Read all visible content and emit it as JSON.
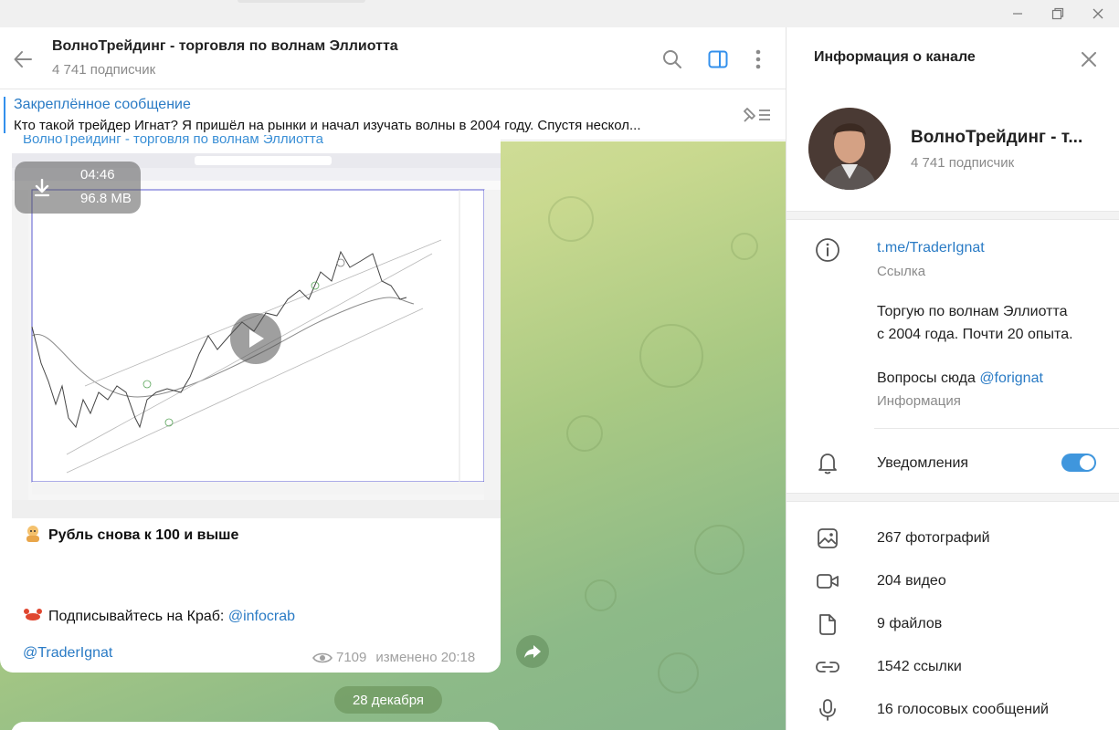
{
  "header": {
    "title": "ВолноТрейдинг - торговля по волнам Эллиотта",
    "subtitle": "4 741 подписчик"
  },
  "pinned": {
    "title": "Закреплённое сообщение",
    "text": "Кто такой трейдер Игнат?  Я пришёл на рынки и начал изучать волны в 2004 году. Спустя нескол..."
  },
  "message": {
    "sender": "ВолноТрейдинг - торговля по волнам Эллиотта",
    "video_duration": "04:46",
    "video_size": "96.8 MB",
    "line1": "Рубль снова к 100 и выше",
    "line2_prefix": "Подписывайтесь на Краб: ",
    "line2_link": "@infocrab",
    "line3": "@TraderIgnat",
    "views": "7109",
    "edited": "изменено 20:18"
  },
  "date_separator": "28 декабря",
  "info_panel": {
    "title": "Информация о канале",
    "channel_name": "ВолноТрейдинг - т...",
    "subscribers": "4 741 подписчик",
    "link": "t.me/TraderIgnat",
    "link_label": "Ссылка",
    "description_line1": "Торгую по волнам Эллиотта",
    "description_line2": "с 2004 года. Почти 20 опыта.",
    "description_line3_prefix": "Вопросы сюда ",
    "description_line3_link": "@forignat",
    "description_label": "Информация",
    "notifications_label": "Уведомления",
    "notifications_on": true,
    "media": [
      {
        "label": "267 фотографий",
        "icon": "photo-icon"
      },
      {
        "label": "204 видео",
        "icon": "video-icon"
      },
      {
        "label": "9 файлов",
        "icon": "file-icon"
      },
      {
        "label": "1542 ссылки",
        "icon": "link-icon"
      },
      {
        "label": "16 голосовых сообщений",
        "icon": "microphone-icon"
      }
    ]
  },
  "colors": {
    "accent": "#3390ec",
    "link": "#2a7bc5",
    "toggle": "#3f96dd"
  }
}
